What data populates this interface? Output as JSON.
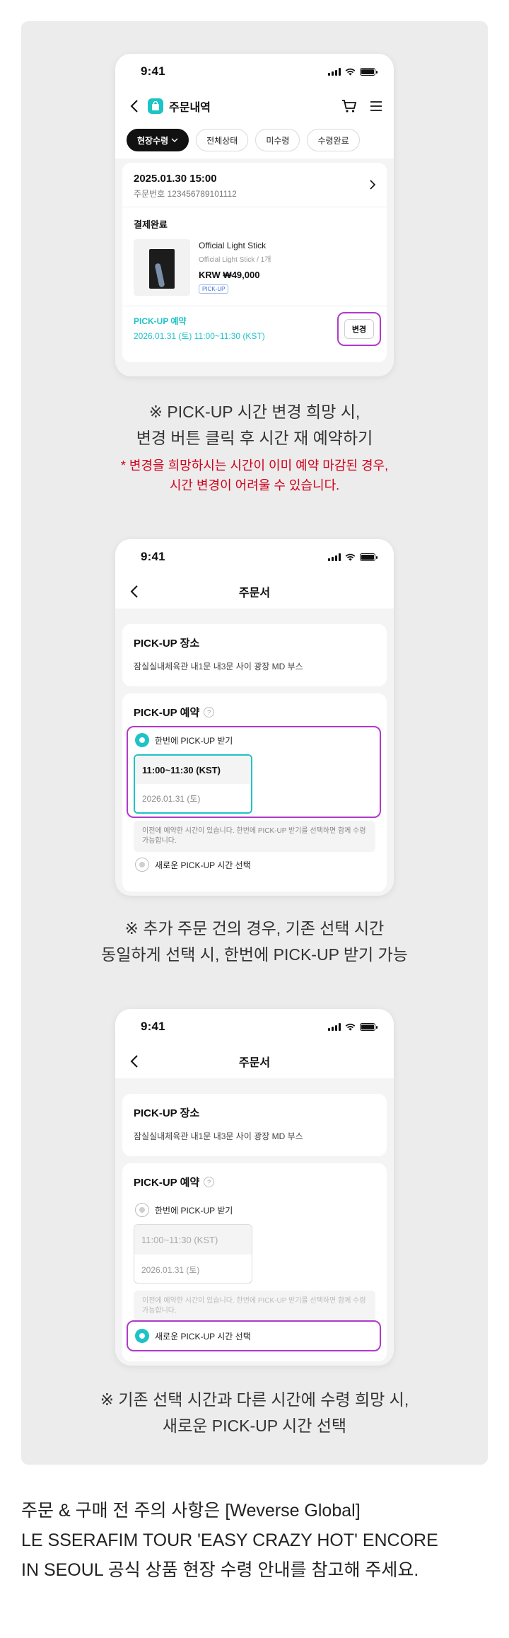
{
  "status": {
    "time": "9:41"
  },
  "screen1": {
    "title": "주문내역",
    "filters": [
      "현장수령",
      "전체상태",
      "미수령",
      "수령완료"
    ],
    "order": {
      "datetime": "2025.01.30 15:00",
      "order_number": "주문번호 123456789101112",
      "status": "결제완료",
      "product_name": "Official Light Stick",
      "product_option": "Official Light Stick / 1개",
      "price": "KRW ₩49,000",
      "badge": "PICK-UP",
      "pickup_label": "PICK-UP 예약",
      "pickup_time": "2026.01.31 (토) 11:00~11:30 (KST)",
      "change_button": "변경"
    }
  },
  "caption1": {
    "line1": "※ PICK-UP 시간 변경 희망 시,",
    "line2": "변경 버튼 클릭 후 시간 재 예약하기"
  },
  "warning1": {
    "line1": "* 변경을 희망하시는 시간이 이미 예약 마감된 경우,",
    "line2": "시간 변경이 어려울 수 있습니다."
  },
  "order_sheet": {
    "title": "주문서",
    "place_title": "PICK-UP 장소",
    "place_value": "잠실실내체육관 내1문 내3문 사이 광장 MD 부스",
    "reserve_title": "PICK-UP 예약",
    "option_same": "한번에 PICK-UP 받기",
    "slot_time": "11:00~11:30 (KST)",
    "slot_date": "2026.01.31 (토)",
    "note": "이전에 예약한 시간이 있습니다.  한번에 PICK-UP 받기를 선택하면 함께 수령 가능합니다.",
    "option_new": "새로운 PICK-UP 시간 선택"
  },
  "caption2": {
    "line1": "※ 추가 주문 건의 경우, 기존 선택 시간",
    "line2": "동일하게 선택 시, 한번에 PICK-UP 받기 가능"
  },
  "caption3": {
    "line1": "※ 기존 선택 시간과 다른 시간에 수령 희망 시,",
    "line2": "새로운 PICK-UP 시간 선택"
  },
  "footer": {
    "line1": "주문 & 구매 전 주의 사항은 [Weverse Global]",
    "line2": "LE SSERAFIM TOUR 'EASY CRAZY HOT' ENCORE",
    "line3": "IN SEOUL 공식 상품 현장 수령 안내를 참고해 주세요."
  },
  "colors": {
    "accent": "#1ec3c7",
    "highlight": "#b03ac9",
    "warning": "#d0021b",
    "panel": "#ececec"
  }
}
